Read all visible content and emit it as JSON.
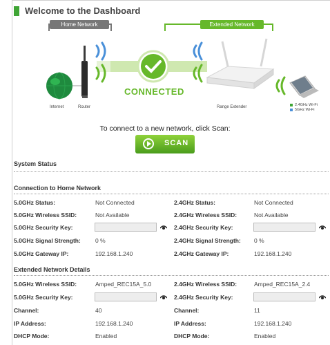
{
  "header": {
    "title": "Welcome to the Dashboard"
  },
  "diagram": {
    "home_tag": "Home Network",
    "extended_tag": "Extended Network",
    "internet_label": "Internet",
    "router_label": "Router",
    "extender_label": "Range Extender",
    "status": "CONNECTED",
    "legend": [
      "2.4GHz Wi-Fi",
      "5GHz Wi-Fi"
    ],
    "colors": {
      "green": "#66b82a",
      "gray": "#777777",
      "legend_green": "#3fa535",
      "legend_blue": "#4a90d9"
    }
  },
  "scan": {
    "prompt": "To connect to a new network, click Scan:",
    "button_label": "SCAN"
  },
  "system_status": {
    "title": "System Status"
  },
  "home": {
    "title": "Connection to Home Network",
    "left": {
      "status_label": "5.0GHz Status:",
      "status": "Not Connected",
      "ssid_label": "5.0GHz Wireless SSID:",
      "ssid": "Not Available",
      "key_label": "5.0GHz Security Key:",
      "signal_label": "5.0GHz Signal Strength:",
      "signal": "0 %",
      "gateway_label": "5.0GHz Gateway IP:",
      "gateway": "192.168.1.240"
    },
    "right": {
      "status_label": "2.4GHz Status:",
      "status": "Not Connected",
      "ssid_label": "2.4GHz Wireless SSID:",
      "ssid": "Not Available",
      "key_label": "2.4GHz Security Key:",
      "signal_label": "2.4GHz Signal Strength:",
      "signal": "0 %",
      "gateway_label": "2.4GHz Gateway IP:",
      "gateway": "192.168.1.240"
    }
  },
  "extended": {
    "title": "Extended Network Details",
    "left": {
      "ssid_label": "5.0GHz Wireless SSID:",
      "ssid": "Amped_REC15A_5.0",
      "key_label": "5.0GHz Security Key:",
      "channel_label": "Channel:",
      "channel": "40",
      "ip_label": "IP Address:",
      "ip": "192.168.1.240",
      "dhcp_label": "DHCP Mode:",
      "dhcp": "Enabled"
    },
    "right": {
      "ssid_label": "2.4GHz Wireless SSID:",
      "ssid": "Amped_REC15A_2.4",
      "key_label": "2.4GHz Security Key:",
      "channel_label": "Channel:",
      "channel": "11",
      "ip_label": "IP Address:",
      "ip": "192.168.1.240",
      "dhcp_label": "DHCP Mode:",
      "dhcp": "Enabled"
    }
  }
}
